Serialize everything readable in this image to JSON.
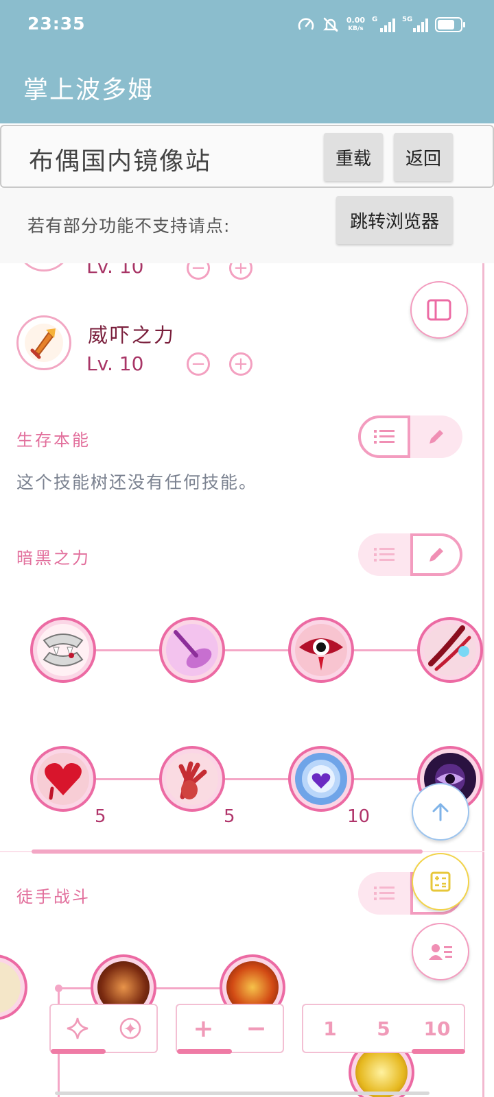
{
  "status_bar": {
    "time": "23:35",
    "net_speed_value": "0.00",
    "net_speed_unit": "KB/s",
    "signal_1_label": "G",
    "signal_2_label": "5G",
    "icons": [
      "speedometer-icon",
      "bell-muted-icon",
      "signal-icon",
      "battery-icon"
    ]
  },
  "app_bar": {
    "title": "掌上波多姆"
  },
  "mirror_bar": {
    "site_name": "布偶国内镜像站",
    "reload_label": "重载",
    "back_label": "返回"
  },
  "notice_bar": {
    "text": "若有部分功能不支持请点:",
    "open_browser_label": "跳转浏览器"
  },
  "skills": [
    {
      "name": "",
      "level_label": "Lv. 10"
    },
    {
      "name": "威吓之力",
      "level_label": "Lv. 10"
    }
  ],
  "sections": {
    "survival": {
      "title": "生存本能",
      "empty_text": "这个技能树还没有任何技能。"
    },
    "dark_power": {
      "title": "暗黑之力",
      "row2_levels": [
        "5",
        "5",
        "10"
      ]
    },
    "unarmed": {
      "title": "徒手战斗"
    }
  },
  "bottom_bar": {
    "step_options": [
      "1",
      "5",
      "10"
    ],
    "plus": "+",
    "minus": "−"
  },
  "colors": {
    "app_bar": "#8bbdcd",
    "accent_pink": "#ec6aa3",
    "section_title": "#e26f9c",
    "fab_yellow": "#f2d34a",
    "fab_blue": "#7fb3e8"
  }
}
